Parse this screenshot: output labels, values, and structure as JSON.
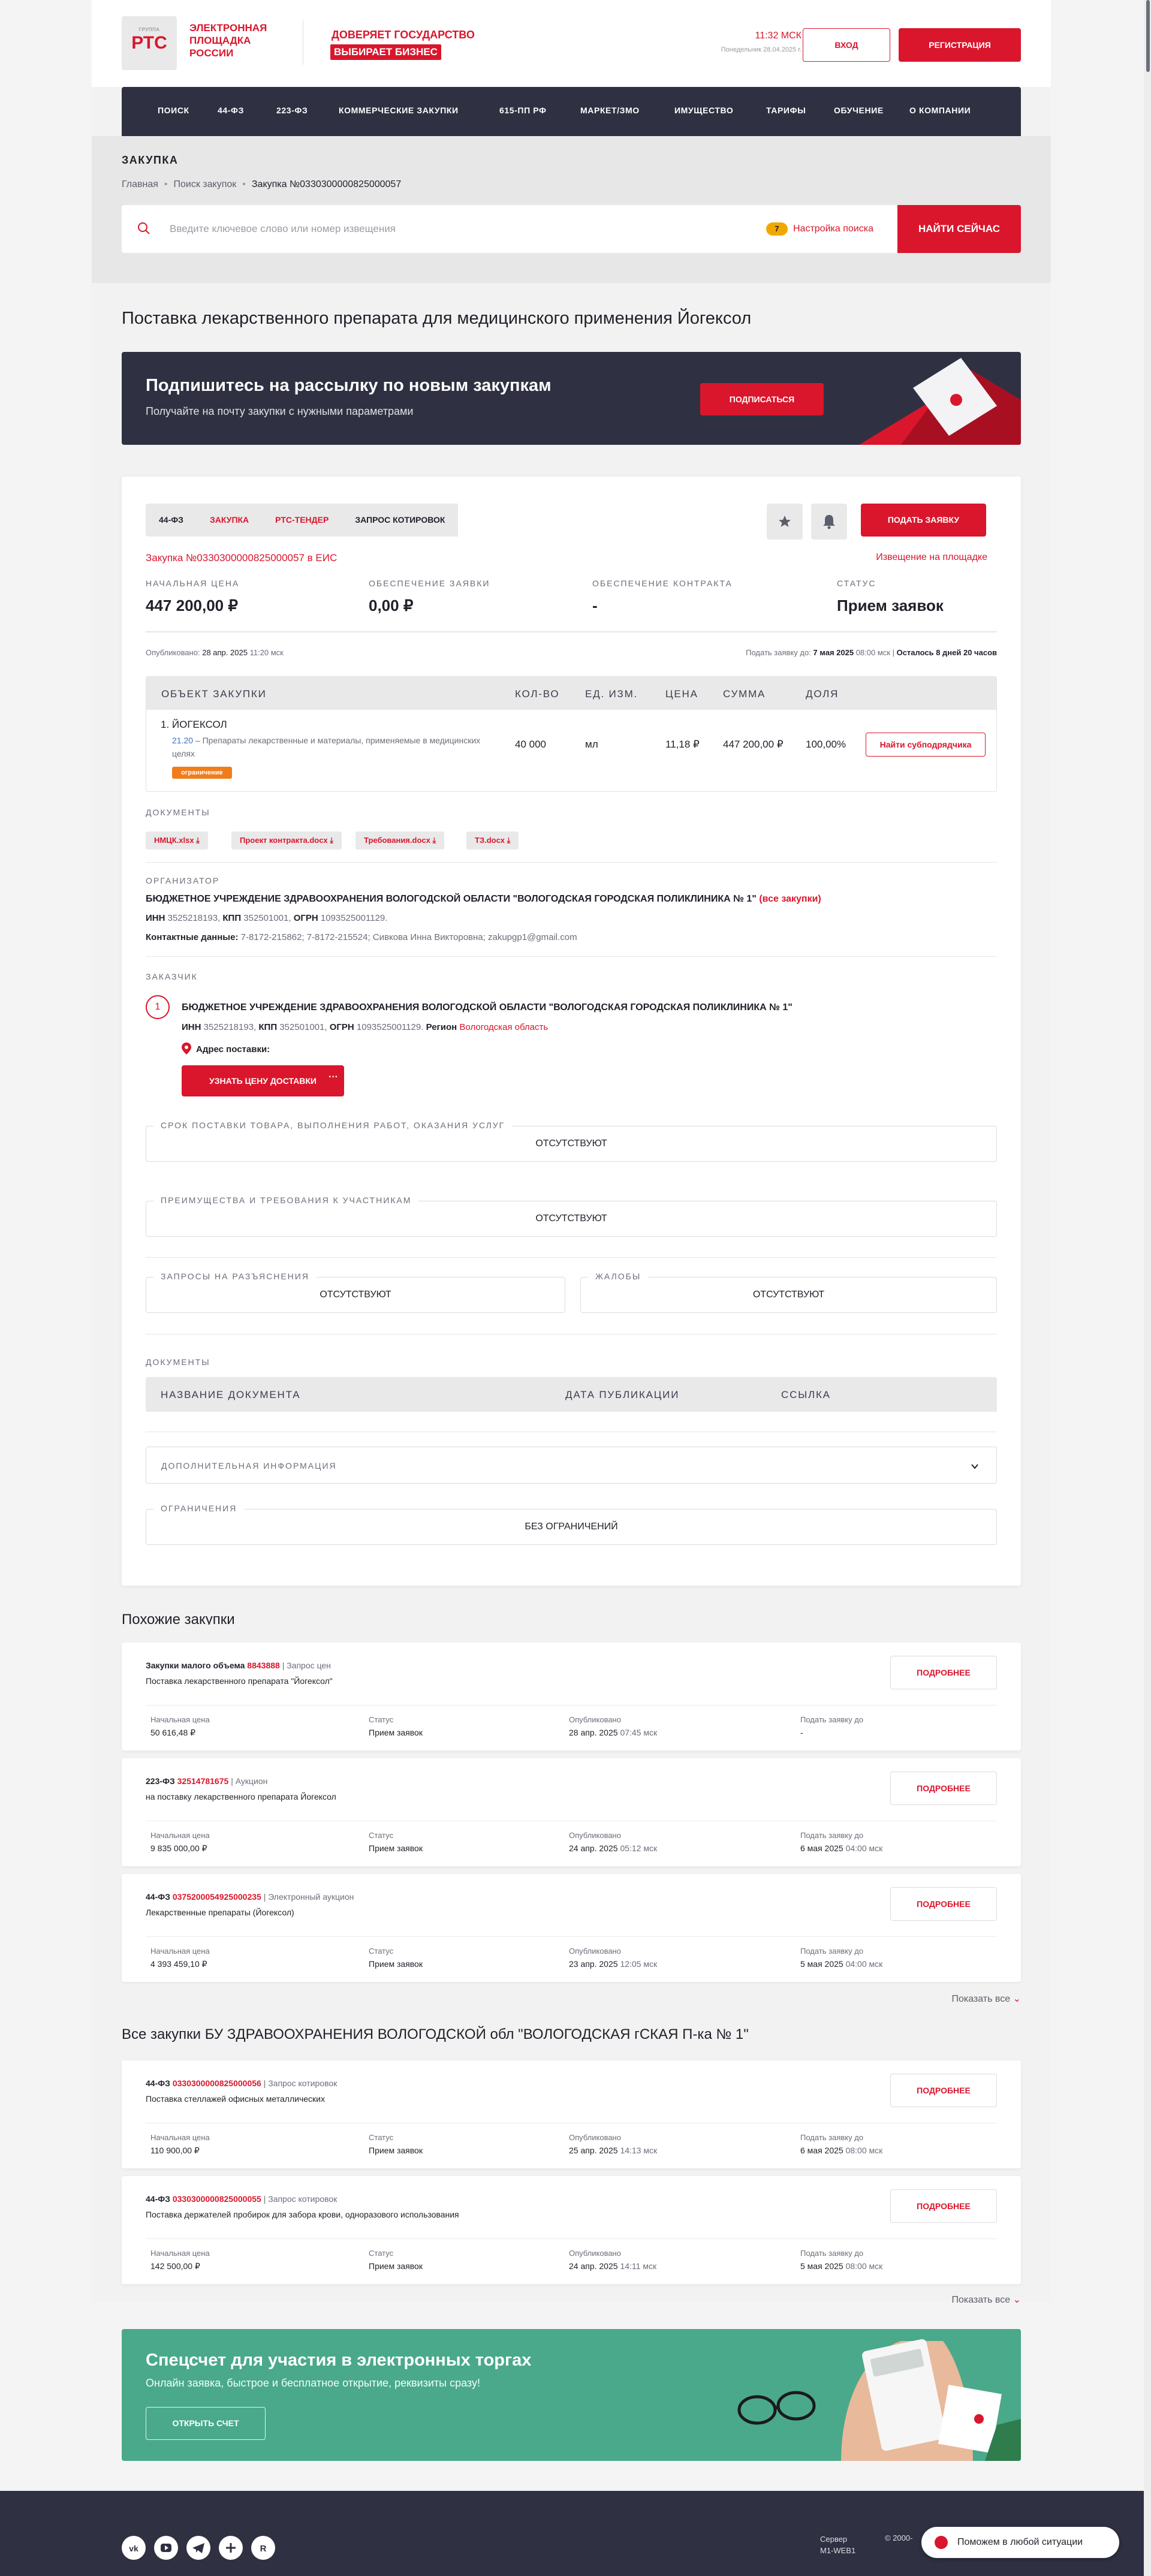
{
  "header": {
    "logo_small": "ГРУППА",
    "logo_big": "РТС",
    "logo_text": "ЭЛЕКТРОННАЯ ПЛОЩАДКА РОССИИ",
    "slogan_top": "ДОВЕРЯЕТ ГОСУДАРСТВО",
    "slogan_bottom": "ВЫБИРАЕТ БИЗНЕС",
    "time": "11:32 МСК",
    "time_sub": "Понедельник 28.04.2025 г.",
    "login_label": "ВХОД",
    "register_label": "РЕГИСТРАЦИЯ"
  },
  "nav": [
    "ПОИСК",
    "44-ФЗ",
    "223-ФЗ",
    "КОММЕРЧЕСКИЕ ЗАКУПКИ",
    "615-ПП РФ",
    "МАРКЕТ/ЗМО",
    "ИМУЩЕСТВО",
    "ТАРИФЫ",
    "ОБУЧЕНИЕ",
    "О КОМПАНИИ"
  ],
  "breadcrumb": {
    "section_title": "ЗАКУПКА",
    "items": [
      "Главная",
      "Поиск закупок",
      "Закупка №0330300000825000057"
    ]
  },
  "search": {
    "placeholder": "Введите ключевое слово или номер извещения",
    "settings_count": "7",
    "settings_label": "Настройка поиска",
    "button_label": "НАЙТИ СЕЙЧАС"
  },
  "page_title": "Поставка лекарственного препарата для медицинского применения Йогексол",
  "subscribe": {
    "title": "Подпишитесь на рассылку по новым закупкам",
    "text": "Получайте на почту закупки с нужными параметрами",
    "button": "ПОДПИСАТЬСЯ"
  },
  "purchase": {
    "tags": [
      "44-ФЗ",
      "ЗАКУПКА",
      "РТС-ТЕНДЕР",
      "ЗАПРОС КОТИРОВОК"
    ],
    "apply_button": "ПОДАТЬ ЗАЯВКУ",
    "eis_link": "Закупка №0330300000825000057 в ЕИС",
    "notice_link": "Извещение на площадке",
    "stats": [
      {
        "label": "НАЧАЛЬНАЯ ЦЕНА",
        "value": "447 200,00 ₽"
      },
      {
        "label": "ОБЕСПЕЧЕНИЕ ЗАЯВКИ",
        "value": "0,00 ₽"
      },
      {
        "label": "ОБЕСПЕЧЕНИЕ КОНТРАКТА",
        "value": "-"
      },
      {
        "label": "СТАТУС",
        "value": "Прием заявок"
      }
    ],
    "published_label": "Опубликовано:",
    "published_date": "28 апр. 2025",
    "published_time": "11:20 мск",
    "deadline_label": "Подать заявку до:",
    "deadline_date": "7 мая 2025",
    "deadline_time": "08:00 мск",
    "deadline_left": "Осталось 8 дней 20 часов"
  },
  "objects": {
    "headers": [
      "ОБЪЕКТ ЗАКУПКИ",
      "КОЛ-ВО",
      "ЕД. ИЗМ.",
      "ЦЕНА",
      "СУММА",
      "ДОЛЯ"
    ],
    "rows": [
      {
        "name": "1. ЙОГЕКСОЛ",
        "okpd_code": "21.20",
        "okpd_text": "– Препараты лекарственные и материалы, применяемые в медицинских целях",
        "badge": "ограничение",
        "qty": "40 000",
        "unit": "мл",
        "price": "11,18 ₽",
        "sum": "447 200,00 ₽",
        "share": "100,00%",
        "action": "Найти субподрядчика"
      }
    ]
  },
  "documents": {
    "label": "ДОКУМЕНТЫ",
    "files": [
      "НМЦК.xlsx",
      "Проект контракта.docx",
      "Требования.docx",
      "ТЗ.docx"
    ]
  },
  "organizer": {
    "label": "ОРГАНИЗАТОР",
    "name": "БЮДЖЕТНОЕ УЧРЕЖДЕНИЕ ЗДРАВООХРАНЕНИЯ ВОЛОГОДСКОЙ ОБЛАСТИ \"ВОЛОГОДСКАЯ ГОРОДСКАЯ ПОЛИКЛИНИКА № 1\"",
    "all_link": "(все закупки)",
    "inn_label": "ИНН",
    "inn": "3525218193,",
    "kpp_label": "КПП",
    "kpp": "352501001,",
    "ogrn_label": "ОГРН",
    "ogrn": "1093525001129.",
    "contacts_label": "Контактные данные:",
    "contacts": "7-8172-215862; 7-8172-215524; Сивкова Инна Викторовна; zakupgp1@gmail.com"
  },
  "customer": {
    "label": "ЗАКАЗЧИК",
    "num": "1",
    "name": "БЮДЖЕТНОЕ УЧРЕЖДЕНИЕ ЗДРАВООХРАНЕНИЯ ВОЛОГОДСКОЙ ОБЛАСТИ \"ВОЛОГОДСКАЯ ГОРОДСКАЯ ПОЛИКЛИНИКА № 1\"",
    "inn": "3525218193,",
    "kpp": "352501001,",
    "ogrn": "1093525001129.",
    "region_label": "Регион",
    "region": "Вологодская область",
    "address_label": "Адрес поставки:",
    "delivery_button": "УЗНАТЬ ЦЕНУ ДОСТАВКИ"
  },
  "blocks": {
    "term_title": "СРОК ПОСТАВКИ ТОВАРА, ВЫПОЛНЕНИЯ РАБОТ, ОКАЗАНИЯ УСЛУГ",
    "term_value": "ОТСУТСТВУЮТ",
    "adv_title": "ПРЕИМУЩЕСТВА И ТРЕБОВАНИЯ К УЧАСТНИКАМ",
    "adv_value": "ОТСУТСТВУЮТ",
    "req_title": "ЗАПРОСЫ НА РАЗЪЯСНЕНИЯ",
    "req_value": "ОТСУТСТВУЮТ",
    "compl_title": "ЖАЛОБЫ",
    "compl_value": "ОТСУТСТВУЮТ",
    "docs_title": "ДОКУМЕНТЫ",
    "docs_headers": [
      "НАЗВАНИЕ ДОКУМЕНТА",
      "ДАТА ПУБЛИКАЦИИ",
      "ССЫЛКА"
    ],
    "extra_title": "ДОПОЛНИТЕЛЬНАЯ ИНФОРМАЦИЯ",
    "limits_title": "ОГРАНИЧЕНИЯ",
    "limits_value": "БЕЗ ОГРАНИЧЕНИЙ"
  },
  "similar": {
    "title": "Похожие закупки",
    "show_all": "Показать все",
    "items": [
      {
        "law": "Закупки малого объема",
        "num": "8843888",
        "type": "| Запрос цен",
        "desc": "Поставка лекарственного препарата \"Йогексол\"",
        "price": "50 616,48 ₽",
        "status": "Прием заявок",
        "published": "28 апр. 2025",
        "published_time": "07:45 мск",
        "deadline": "-",
        "deadline_time": ""
      },
      {
        "law": "223-ФЗ",
        "num": "32514781675",
        "type": "| Аукцион",
        "desc": "на поставку лекарственного препарата Йогексол",
        "price": "9 835 000,00 ₽",
        "status": "Прием заявок",
        "published": "24 апр. 2025",
        "published_time": "05:12 мск",
        "deadline": "6 мая 2025",
        "deadline_time": "04:00 мск"
      },
      {
        "law": "44-ФЗ",
        "num": "0375200054925000235",
        "type": "| Электронный аукцион",
        "desc": "Лекарственные препараты (Йогексол)",
        "price": "4 393 459,10 ₽",
        "status": "Прием заявок",
        "published": "23 апр. 2025",
        "published_time": "12:05 мск",
        "deadline": "5 мая 2025",
        "deadline_time": "04:00 мск"
      }
    ]
  },
  "all_purchases": {
    "title": "Все закупки БУ ЗДРАВООХРАНЕНИЯ ВОЛОГОДСКОЙ обл \"ВОЛОГОДСКАЯ гСКАЯ П-ка № 1\"",
    "show_all": "Показать все",
    "items": [
      {
        "law": "44-ФЗ",
        "num": "0330300000825000056",
        "type": "| Запрос котировок",
        "desc": "Поставка стеллажей офисных металлических",
        "price": "110 900,00 ₽",
        "status": "Прием заявок",
        "published": "25 апр. 2025",
        "published_time": "14:13 мск",
        "deadline": "6 мая 2025",
        "deadline_time": "08:00 мск"
      },
      {
        "law": "44-ФЗ",
        "num": "0330300000825000055",
        "type": "| Запрос котировок",
        "desc": "Поставка держателей пробирок для забора крови, одноразового использования",
        "price": "142 500,00 ₽",
        "status": "Прием заявок",
        "published": "24 апр. 2025",
        "published_time": "14:11 мск",
        "deadline": "5 мая 2025",
        "deadline_time": "08:00 мск"
      }
    ]
  },
  "card_labels": {
    "price": "Начальная цена",
    "status": "Статус",
    "published": "Опубликовано",
    "deadline": "Подать заявку до",
    "more": "ПОДРОБНЕЕ"
  },
  "promo": {
    "title": "Спецсчет для участия в электронных торгах",
    "text": "Онлайн заявка, быстрое и бесплатное открытие, реквизиты сразу!",
    "button": "ОТКРЫТЬ СЧЕТ"
  },
  "footer": {
    "server_label": "Сервер",
    "server_name": "M1-WEB1",
    "copyright": "© 2000-",
    "help": "Поможем в любой ситуации"
  },
  "colors": {
    "accent": "#d9162c",
    "nav_bg": "#2f3142",
    "promo_bg": "#4aa98a",
    "badge_orange": "#f07d1a",
    "link_blue": "#3b6fcf"
  }
}
